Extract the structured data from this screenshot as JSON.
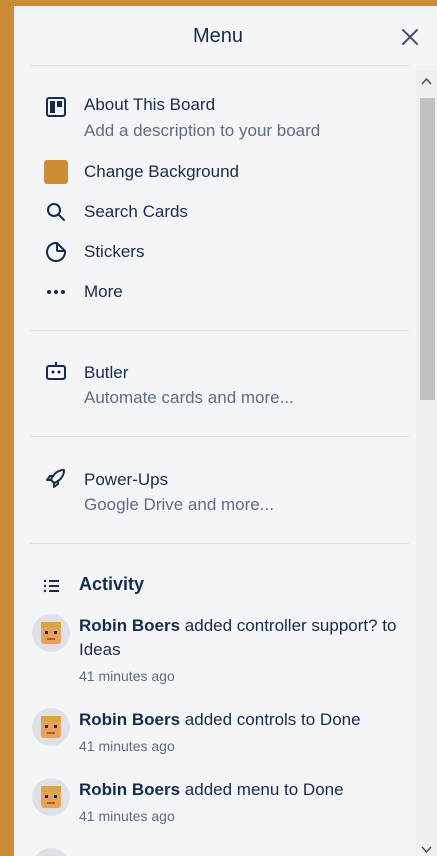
{
  "header": {
    "title": "Menu"
  },
  "menu_items": [
    {
      "label": "About This Board",
      "sub": "Add a description to your board"
    },
    {
      "label": "Change Background"
    },
    {
      "label": "Search Cards"
    },
    {
      "label": "Stickers"
    },
    {
      "label": "More"
    }
  ],
  "butler": {
    "label": "Butler",
    "sub": "Automate cards and more..."
  },
  "powerups": {
    "label": "Power-Ups",
    "sub": "Google Drive and more..."
  },
  "activity": {
    "title": "Activity",
    "entries": [
      {
        "user": "Robin Boers",
        "action": " added controller support? to Ideas",
        "time": "41 minutes ago"
      },
      {
        "user": "Robin Boers",
        "action": " added controls to Done",
        "time": "41 minutes ago"
      },
      {
        "user": "Robin Boers",
        "action": " added menu to Done",
        "time": "41 minutes ago"
      }
    ]
  },
  "colors": {
    "background": "#CD8D38",
    "panel": "#F4F5F7",
    "text": "#172B4D",
    "subtext": "#5E6C84"
  }
}
